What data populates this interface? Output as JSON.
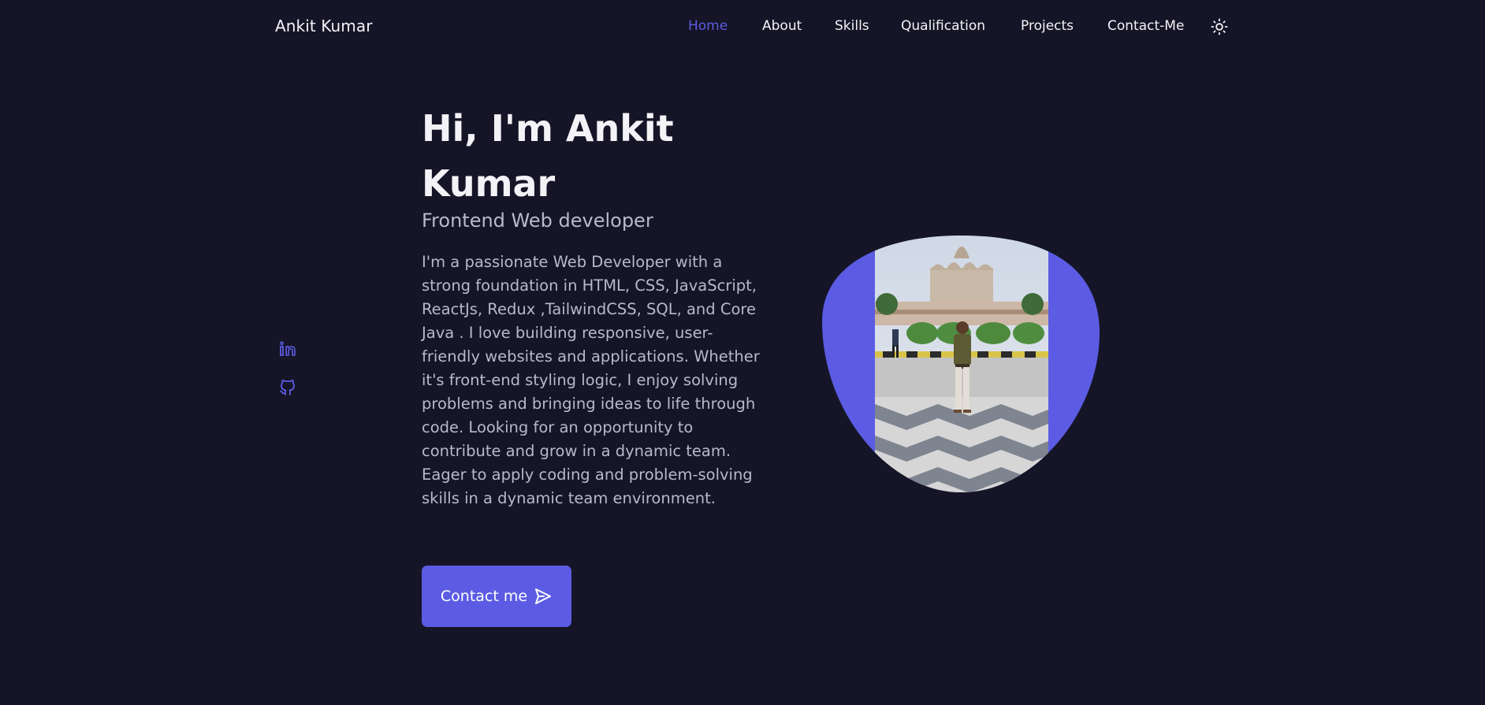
{
  "header": {
    "logo": "Ankit Kumar",
    "nav": [
      {
        "label": "Home",
        "active": true
      },
      {
        "label": "About",
        "active": false
      },
      {
        "label": "Skills",
        "active": false
      },
      {
        "label": "Qualification",
        "active": false
      },
      {
        "label": "Projects",
        "active": false
      },
      {
        "label": "Contact-Me",
        "active": false
      }
    ],
    "theme_icon": "sun-icon"
  },
  "social": [
    {
      "name": "linkedin-icon"
    },
    {
      "name": "github-icon"
    }
  ],
  "hero": {
    "title": "Hi, I'm Ankit Kumar",
    "subtitle": "Frontend Web developer",
    "description": "I'm a passionate Web Developer with a strong foundation in HTML, CSS, JavaScript, ReactJs, Redux ,TailwindCSS, SQL, and Core Java . I love building responsive, user-friendly websites and applications. Whether it's front-end styling logic, I enjoy solving problems and bringing ideas to life through code. Looking for an opportunity to contribute and grow in a dynamic team. Eager to apply coding and problem-solving skills in a dynamic team environment.",
    "contact_button": "Contact me"
  },
  "colors": {
    "background": "#161527",
    "accent": "#5b5ce3",
    "text": "#f3f3f7",
    "muted_text": "#b9b8cc"
  }
}
